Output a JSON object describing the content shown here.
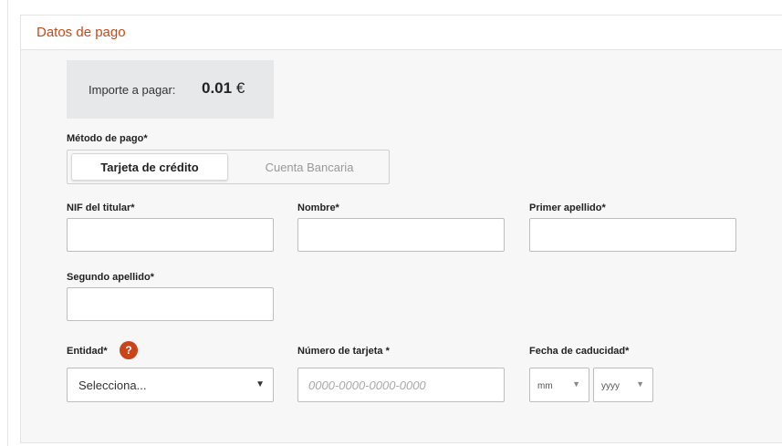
{
  "section": {
    "title": "Datos de pago"
  },
  "amount": {
    "label": "Importe a pagar:",
    "value": "0.01",
    "currency": "€"
  },
  "payment_method": {
    "label": "Método de pago*",
    "options": [
      {
        "label": "Tarjeta de crédito",
        "selected": true
      },
      {
        "label": "Cuenta Bancaria",
        "selected": false
      }
    ]
  },
  "fields": {
    "nif": {
      "label": "NIF del titular*",
      "value": ""
    },
    "nombre": {
      "label": "Nombre*",
      "value": ""
    },
    "primer_apellido": {
      "label": "Primer apellido*",
      "value": ""
    },
    "segundo_apellido": {
      "label": "Segundo apellido*",
      "value": ""
    },
    "entidad": {
      "label": "Entidad*",
      "selected": "Selecciona...",
      "help_icon": "?"
    },
    "numero_tarjeta": {
      "label": "Número de tarjeta *",
      "placeholder": "0000-0000-0000-0000",
      "value": ""
    },
    "fecha_caducidad": {
      "label": "Fecha de caducidad*",
      "month": "mm",
      "year": "yyyy"
    }
  },
  "colors": {
    "accent": "#c64a16",
    "help_icon": "#c9441b",
    "panel_bg": "#f7f7f7"
  }
}
